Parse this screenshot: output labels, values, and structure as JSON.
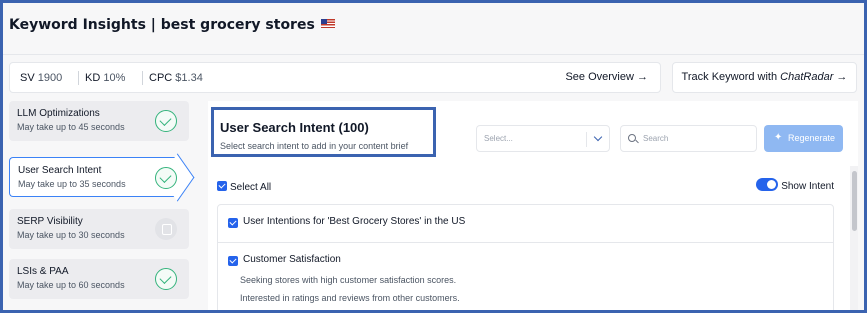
{
  "header": {
    "title": "Keyword Insights | best grocery stores"
  },
  "metrics": {
    "sv_label": "SV",
    "sv_value": "1900",
    "kd_label": "KD",
    "kd_value": "10%",
    "cpc_label": "CPC",
    "cpc_value": "$1.34",
    "see_overview": "See Overview →"
  },
  "track": {
    "prefix": "Track Keyword with ",
    "brand": "ChatRadar",
    "suffix": " →"
  },
  "sidebar": {
    "items": [
      {
        "label": "LLM Optimizations",
        "sub": "May take up to 45 seconds",
        "status": "done"
      },
      {
        "label": "User Search Intent",
        "sub": "May take up to 35 seconds",
        "status": "done"
      },
      {
        "label": "SERP Visibility",
        "sub": "May take up to 30 seconds",
        "status": "pending"
      },
      {
        "label": "LSIs & PAA",
        "sub": "May take up to 60 seconds",
        "status": "done"
      }
    ]
  },
  "main": {
    "heading": "User Search Intent (100)",
    "subheading": "Select search intent to add in your content brief",
    "select_placeholder": "Select...",
    "search_placeholder": "Search",
    "regenerate": "Regenerate",
    "select_all": "Select All",
    "show_intent": "Show Intent",
    "rows": [
      {
        "title": "User Intentions for 'Best Grocery Stores' in the US"
      },
      {
        "title": "Customer Satisfaction",
        "details": [
          "Seeking stores with high customer satisfaction scores.",
          "Interested in ratings and reviews from other customers."
        ]
      }
    ]
  },
  "colors": {
    "accent": "#2563eb",
    "success": "#34b37c",
    "highlight_border": "#3b63b0"
  }
}
